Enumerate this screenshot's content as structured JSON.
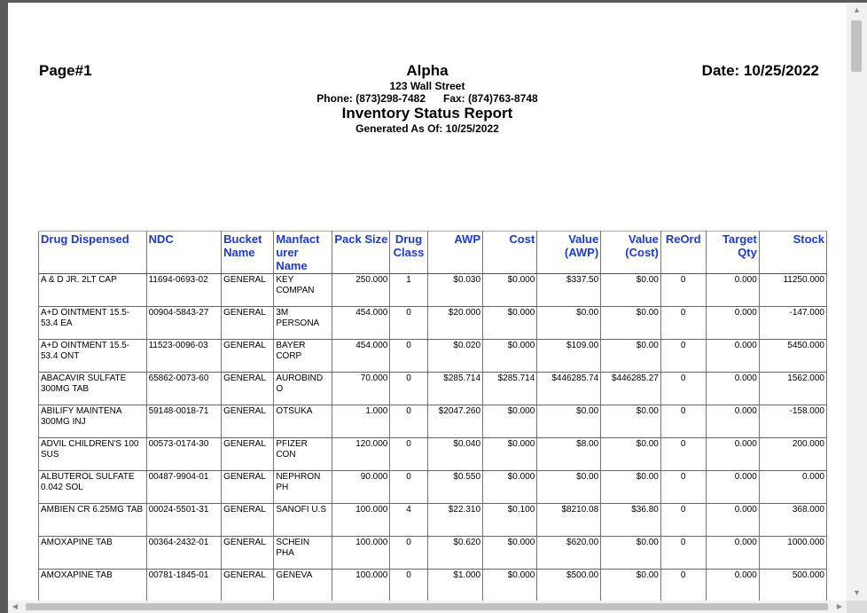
{
  "header": {
    "page_label": "Page#1",
    "company": "Alpha",
    "address": "123 Wall Street",
    "phone": "Phone: (873)298-7482",
    "fax": "Fax: (874)763-8748",
    "report_title": "Inventory Status Report",
    "generated": "Generated As Of:  10/25/2022",
    "date_label": "Date: 10/25/2022"
  },
  "table": {
    "columns": [
      {
        "label": "Drug Dispensed",
        "align": "l"
      },
      {
        "label": "NDC",
        "align": "l"
      },
      {
        "label": "Bucket Name",
        "align": "l"
      },
      {
        "label": "Manfact urer Name",
        "align": "l"
      },
      {
        "label": "Pack Size",
        "align": "r"
      },
      {
        "label": "Drug Class",
        "align": "c"
      },
      {
        "label": "AWP",
        "align": "r"
      },
      {
        "label": "Cost",
        "align": "r"
      },
      {
        "label": "Value (AWP)",
        "align": "r"
      },
      {
        "label": "Value (Cost)",
        "align": "r"
      },
      {
        "label": "ReOrd",
        "align": "c"
      },
      {
        "label": "Target Qty",
        "align": "r"
      },
      {
        "label": "Stock",
        "align": "r"
      }
    ],
    "rows": [
      [
        "A & D JR. 2LT CAP",
        "11694-0693-02",
        "GENERAL",
        "KEY COMPAN",
        "250.000",
        "1",
        "$0.030",
        "$0.000",
        "$337.50",
        "$0.00",
        "0",
        "0.000",
        "11250.000"
      ],
      [
        "A+D OINTMENT 15.5-53.4 EA",
        "00904-5843-27",
        "GENERAL",
        "3M PERSONA",
        "454.000",
        "0",
        "$20.000",
        "$0.000",
        "$0.00",
        "$0.00",
        "0",
        "0.000",
        "-147.000"
      ],
      [
        "A+D OINTMENT 15.5-53.4 ONT",
        "11523-0096-03",
        "GENERAL",
        "BAYER CORP",
        "454.000",
        "0",
        "$0.020",
        "$0.000",
        "$109.00",
        "$0.00",
        "0",
        "0.000",
        "5450.000"
      ],
      [
        "ABACAVIR SULFATE 300MG TAB",
        "65862-0073-60",
        "GENERAL",
        "AUROBIND O",
        "70.000",
        "0",
        "$285.714",
        "$285.714",
        "$446285.74",
        "$446285.27",
        "0",
        "0.000",
        "1562.000"
      ],
      [
        "ABILIFY MAINTENA 300MG INJ",
        "59148-0018-71",
        "GENERAL",
        "OTSUKA",
        "1.000",
        "0",
        "$2047.260",
        "$0.000",
        "$0.00",
        "$0.00",
        "0",
        "0.000",
        "-158.000"
      ],
      [
        "ADVIL CHILDREN'S 100 SUS",
        "00573-0174-30",
        "GENERAL",
        "PFIZER CON",
        "120.000",
        "0",
        "$0.040",
        "$0.000",
        "$8.00",
        "$0.00",
        "0",
        "0.000",
        "200.000"
      ],
      [
        "ALBUTEROL SULFATE 0.042 SOL",
        "00487-9904-01",
        "GENERAL",
        "NEPHRON PH",
        "90.000",
        "0",
        "$0.550",
        "$0.000",
        "$0.00",
        "$0.00",
        "0",
        "0.000",
        "0.000"
      ],
      [
        "AMBIEN CR 6.25MG TAB",
        "00024-5501-31",
        "GENERAL",
        "SANOFI U.S",
        "100.000",
        "4",
        "$22.310",
        "$0.100",
        "$8210.08",
        "$36.80",
        "0",
        "0.000",
        "368.000"
      ],
      [
        "AMOXAPINE  TAB",
        "00364-2432-01",
        "GENERAL",
        "SCHEIN PHA",
        "100.000",
        "0",
        "$0.620",
        "$0.000",
        "$620.00",
        "$0.00",
        "0",
        "0.000",
        "1000.000"
      ],
      [
        "AMOXAPINE  TAB",
        "00781-1845-01",
        "GENERAL",
        "GENEVA",
        "100.000",
        "0",
        "$1.000",
        "$0.000",
        "$500.00",
        "$0.00",
        "0",
        "0.000",
        "500.000"
      ]
    ]
  }
}
